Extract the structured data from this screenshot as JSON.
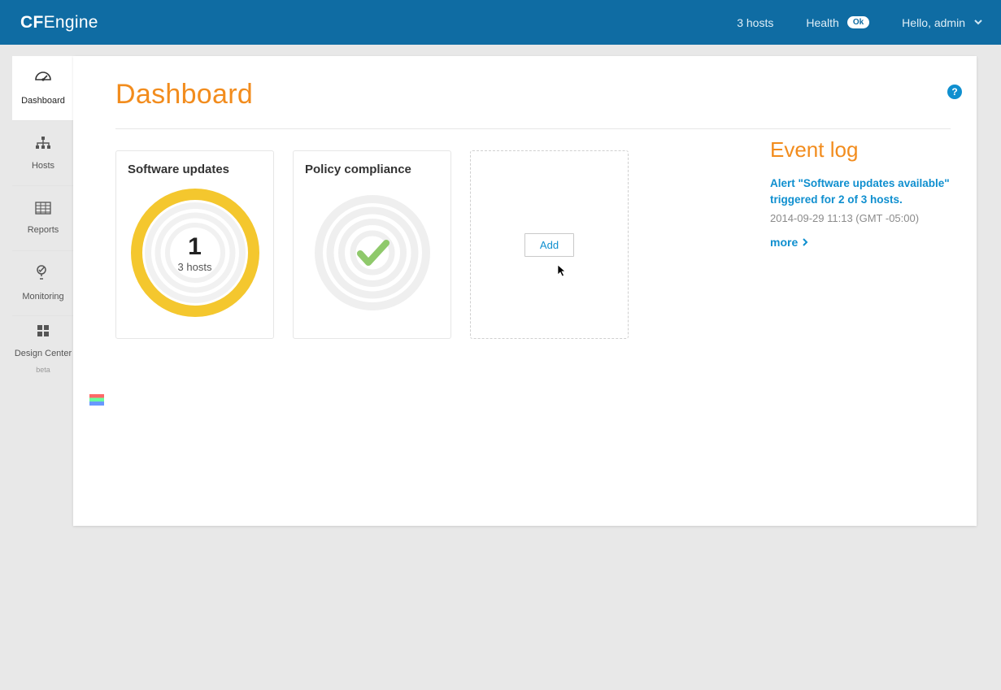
{
  "header": {
    "logo_bold": "CF",
    "logo_rest": "Engine",
    "hosts_label": "3 hosts",
    "health": {
      "label": "Health",
      "status": "Ok"
    },
    "greeting": "Hello, admin"
  },
  "sidenav": {
    "items": [
      {
        "label": "Dashboard",
        "icon": "dashboard"
      },
      {
        "label": "Hosts",
        "icon": "hosts"
      },
      {
        "label": "Reports",
        "icon": "reports"
      },
      {
        "label": "Monitoring",
        "icon": "monitoring"
      },
      {
        "label": "Design Center",
        "icon": "designcenter",
        "beta": "beta"
      }
    ]
  },
  "page": {
    "title": "Dashboard"
  },
  "widgets": {
    "software_updates": {
      "title": "Software updates",
      "count": "1",
      "sub": "3 hosts",
      "ring_color": "#f4c72e"
    },
    "policy_compliance": {
      "title": "Policy compliance"
    },
    "add_label": "Add"
  },
  "eventlog": {
    "title": "Event log",
    "alert_text": "Alert \"Software updates available\" triggered for 2 of 3 hosts.",
    "timestamp": "2014-09-29 11:13 (GMT -05:00)",
    "more": "more"
  }
}
